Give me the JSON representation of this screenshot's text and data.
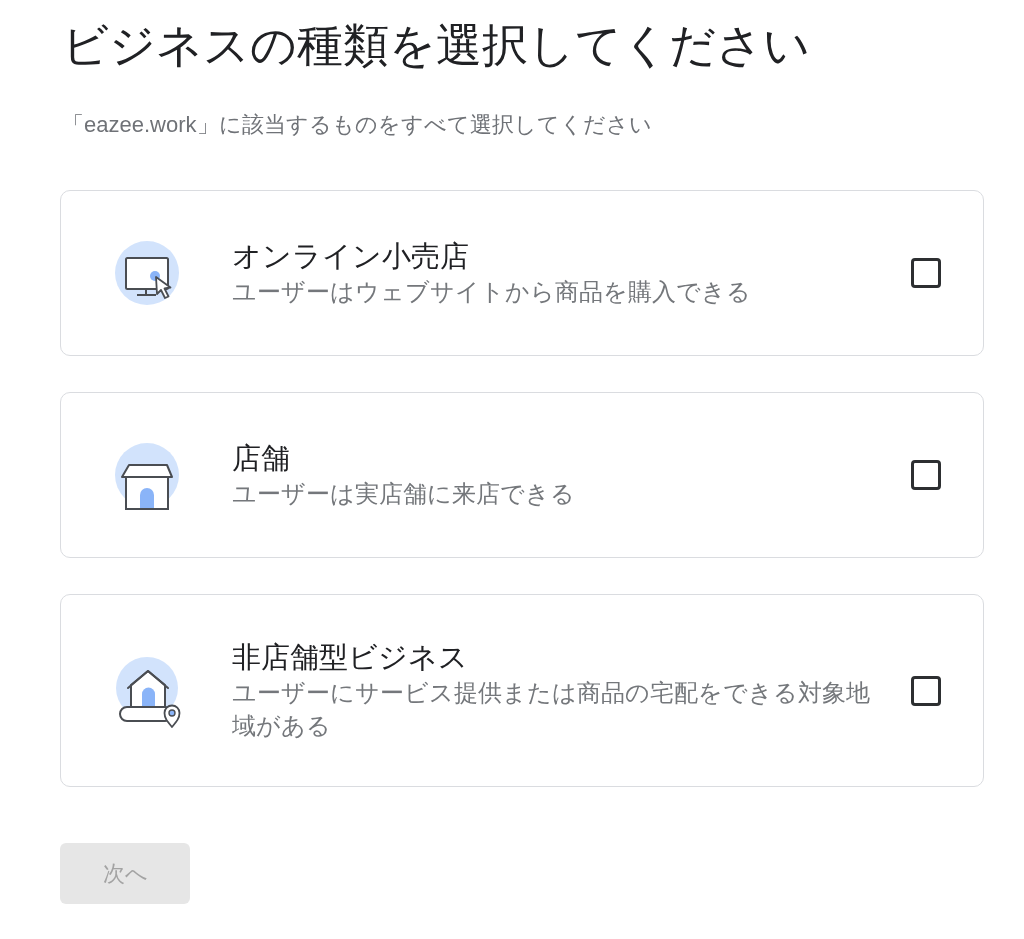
{
  "heading": "ビジネスの種類を選択してください",
  "subheading": "「eazee.work」に該当するものをすべて選択してください",
  "options": [
    {
      "title": "オンライン小売店",
      "description": "ユーザーはウェブサイトから商品を購入できる",
      "checked": false
    },
    {
      "title": "店舗",
      "description": "ユーザーは実店舗に来店できる",
      "checked": false
    },
    {
      "title": "非店舗型ビジネス",
      "description": "ユーザーにサービス提供または商品の宅配をできる対象地域がある",
      "checked": false
    }
  ],
  "next_button": {
    "label": "次へ",
    "disabled": true
  }
}
